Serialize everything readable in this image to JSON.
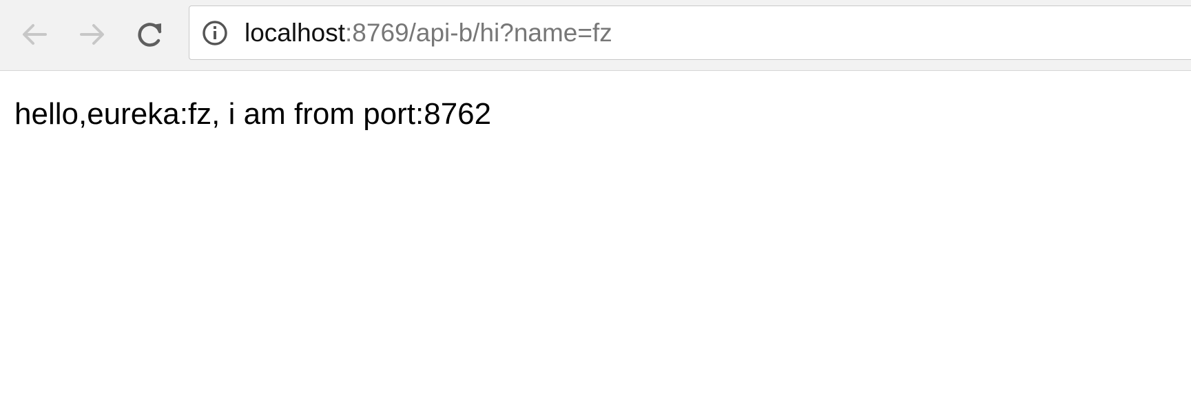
{
  "browser": {
    "address_bar": {
      "host": "localhost",
      "path": ":8769/api-b/hi?name=fz"
    },
    "icons": {
      "back": "back-arrow-icon",
      "forward": "forward-arrow-icon",
      "reload": "reload-icon",
      "site_info": "info-icon"
    },
    "colors": {
      "toolbar_bg": "#f2f2f2",
      "disabled_icon": "#c7c7c7",
      "active_icon": "#5f5f5f"
    }
  },
  "page": {
    "body_text": "hello,eureka:fz, i am from port:8762"
  }
}
